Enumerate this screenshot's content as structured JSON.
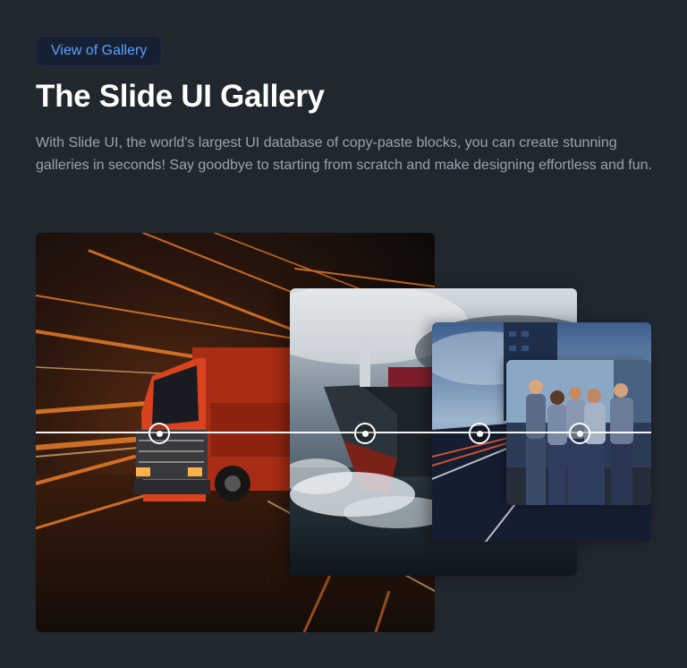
{
  "header": {
    "badge_label": "View of Gallery",
    "title": "The Slide UI Gallery",
    "description": "With Slide UI, the world's largest UI database of copy-paste blocks, you can create stunning galleries in seconds! Say goodbye to starting from scratch and make designing effortless and fun."
  },
  "gallery": {
    "images": [
      {
        "subject": "orange semi truck with light-speed motion trails"
      },
      {
        "subject": "container cargo ship at sea with stormy sky"
      },
      {
        "subject": "city highway with car light trails at dusk"
      },
      {
        "subject": "group of five smiling workers in uniforms"
      }
    ]
  },
  "colors": {
    "background": "#21272e",
    "accent": "#5aa0ff",
    "title": "#ffffff",
    "text_muted": "#9aa3ad"
  }
}
